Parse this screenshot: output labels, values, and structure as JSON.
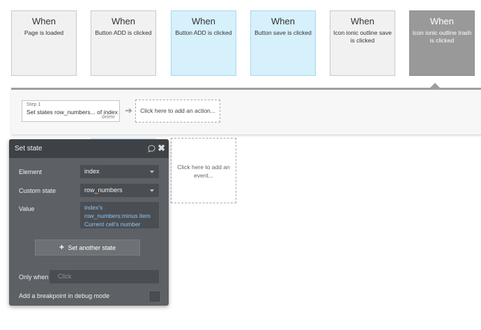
{
  "events": [
    {
      "when": "When",
      "desc": "Page is loaded"
    },
    {
      "when": "When",
      "desc": "Button ADD is clicked"
    },
    {
      "when": "When",
      "desc": "Button ADD is clicked"
    },
    {
      "when": "When",
      "desc": "Button save is clicked"
    },
    {
      "when": "When",
      "desc": "Icon ionic outline save is clicked"
    },
    {
      "when": "When",
      "desc": "Icon ionic outline trash is clicked"
    }
  ],
  "workflow": {
    "step_label": "Step 1",
    "step_title": "Set states row_numbers... of index",
    "step_delete": "delete",
    "add_action": "Click here to add an action..."
  },
  "add_event": "Click here to add an event...",
  "set_state": {
    "title": "Set state",
    "element_label": "Element",
    "element_value": "index",
    "custom_state_label": "Custom state",
    "custom_state_value": "row_numbers",
    "value_label": "Value",
    "value_lines": [
      "index's",
      "row_numbers:minus item",
      "Current cell's number"
    ],
    "set_another": "Set another state",
    "only_when_label": "Only when",
    "only_when_placeholder": "Click",
    "breakpoint_label": "Add a breakpoint in debug mode"
  },
  "icons": {
    "plus": "+",
    "arrow": "➔",
    "close": "✖"
  },
  "colors": {
    "event_default": "#f0f1f0",
    "event_blue": "#d6f0fc",
    "event_selected": "#999999",
    "panel_bg": "#5d6166",
    "value_text": "#8ec5f3"
  }
}
